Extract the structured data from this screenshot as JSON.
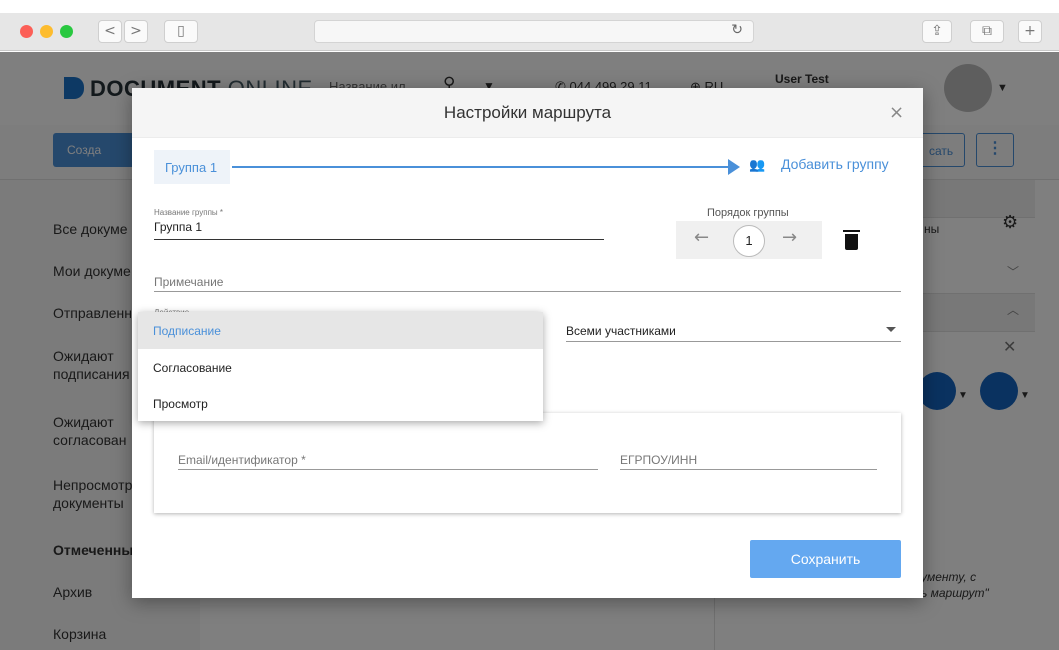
{
  "browser": {
    "back": "<",
    "forward": ">",
    "reload_icon": "↻",
    "share_icon": "⇪",
    "tabs_icon": "⧉",
    "new_tab": "+"
  },
  "app": {
    "logo_bold": "DOCUMENT",
    "logo_thin": "ONLINE",
    "search_placeholder": "Название ил...",
    "phone": "044 499 29 11",
    "lang": "RU",
    "user_name": "User Test",
    "create_label": "Созда",
    "sign_label": "сать"
  },
  "sidebar": {
    "items": [
      "Все докуме",
      "Мои докуме",
      "Отправленн",
      "Ожидают",
      "подписания",
      "Ожидают",
      "согласован",
      "Непросмотр",
      "документы",
      "Отмеченны",
      "Архив",
      "Корзина"
    ]
  },
  "right_panel": {
    "row_text": "ны",
    "note_line1": "ументу, с",
    "note_line2": "ь маршрут\""
  },
  "modal": {
    "title": "Настройки маршрута",
    "close": "×",
    "group_tab": "Группа 1",
    "add_group": "Добавить группу",
    "group_name_label": "Название группы *",
    "group_name_value": "Группа 1",
    "order_label": "Порядок группы",
    "order_value": "1",
    "order_prev": "←",
    "order_next": "→",
    "note_placeholder": "Примечание",
    "action_label": "Действие",
    "participants_value": "Всеми участниками",
    "email_placeholder": "Email/идентификатор *",
    "edrpou_placeholder": "ЕГРПОУ/ИНН",
    "save": "Сохранить"
  },
  "dropdown": {
    "options": [
      "Подписание",
      "Согласование",
      "Просмотр"
    ],
    "selected": "Подписание"
  },
  "colors": {
    "accent": "#4a90d9",
    "save_button": "#64a8f0",
    "backdrop": "rgba(0,0,0,0.5)"
  }
}
